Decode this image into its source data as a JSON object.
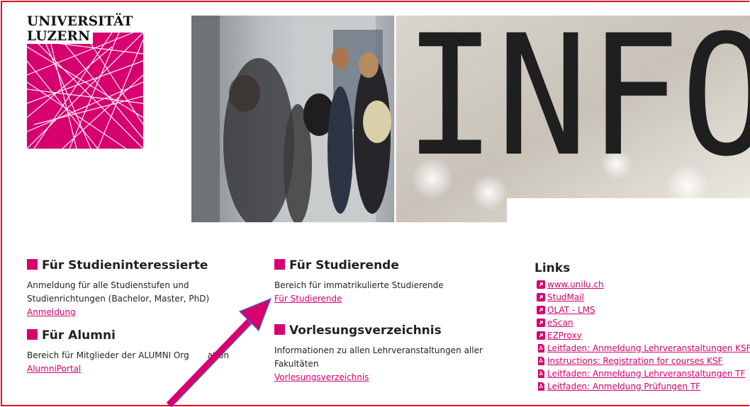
{
  "logo": {
    "line1": "UNIVERSITÄT",
    "line2": "LUZERN"
  },
  "hero": {
    "headline": "INFO"
  },
  "colors": {
    "accent": "#d6006f",
    "frame": "#e0101b"
  },
  "sections": {
    "studieninteressierte": {
      "title": "Für Studieninteressierte",
      "text": "Anmeldung für alle Studienstufen und Studienrichtungen (Bachelor, Master, PhD)",
      "link": "Anmeldung"
    },
    "alumni": {
      "title": "Für Alumni",
      "text": "Bereich für Mitglieder der ALUMNI Org",
      "text_end": "ation",
      "link": "AlumniPortal"
    },
    "studierende": {
      "title": "Für Studierende",
      "text": "Bereich für immatrikulierte Studierende",
      "link": "Für Studierende"
    },
    "vorlesungsverzeichnis": {
      "title": "Vorlesungsverzeichnis",
      "text": "Informationen zu allen Lehrveranstaltungen aller Fakultäten",
      "link": "Vorlesungsverzeichnis"
    }
  },
  "links": {
    "title": "Links",
    "items": [
      {
        "label": "www.unilu.ch",
        "icon": "external-link-icon"
      },
      {
        "label": "StudMail",
        "icon": "external-link-icon"
      },
      {
        "label": "OLAT - LMS",
        "icon": "external-link-icon"
      },
      {
        "label": "eScan",
        "icon": "external-link-icon"
      },
      {
        "label": "EZProxy",
        "icon": "external-link-icon"
      },
      {
        "label": "Leitfaden: Anmeldung Lehrveranstaltungen KSF",
        "icon": "pdf-icon"
      },
      {
        "label": "Instructions: Registration for courses KSF",
        "icon": "pdf-icon"
      },
      {
        "label": "Leitfaden: Anmeldung Lehrveranstaltungen TF",
        "icon": "pdf-icon"
      },
      {
        "label": "Leitfaden: Anmeldung Prüfungen TF",
        "icon": "pdf-icon"
      }
    ]
  }
}
